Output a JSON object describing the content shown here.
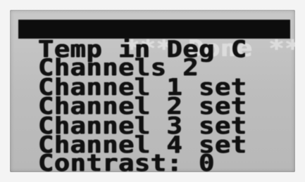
{
  "screen": {
    "header": "*** Done ***",
    "lines": [
      "Temp in Deg C",
      "Channels 2",
      "Channel 1 set",
      "Channel 2 set",
      "Channel 3 set",
      "Channel 4 set",
      "Contrast: 0"
    ]
  }
}
